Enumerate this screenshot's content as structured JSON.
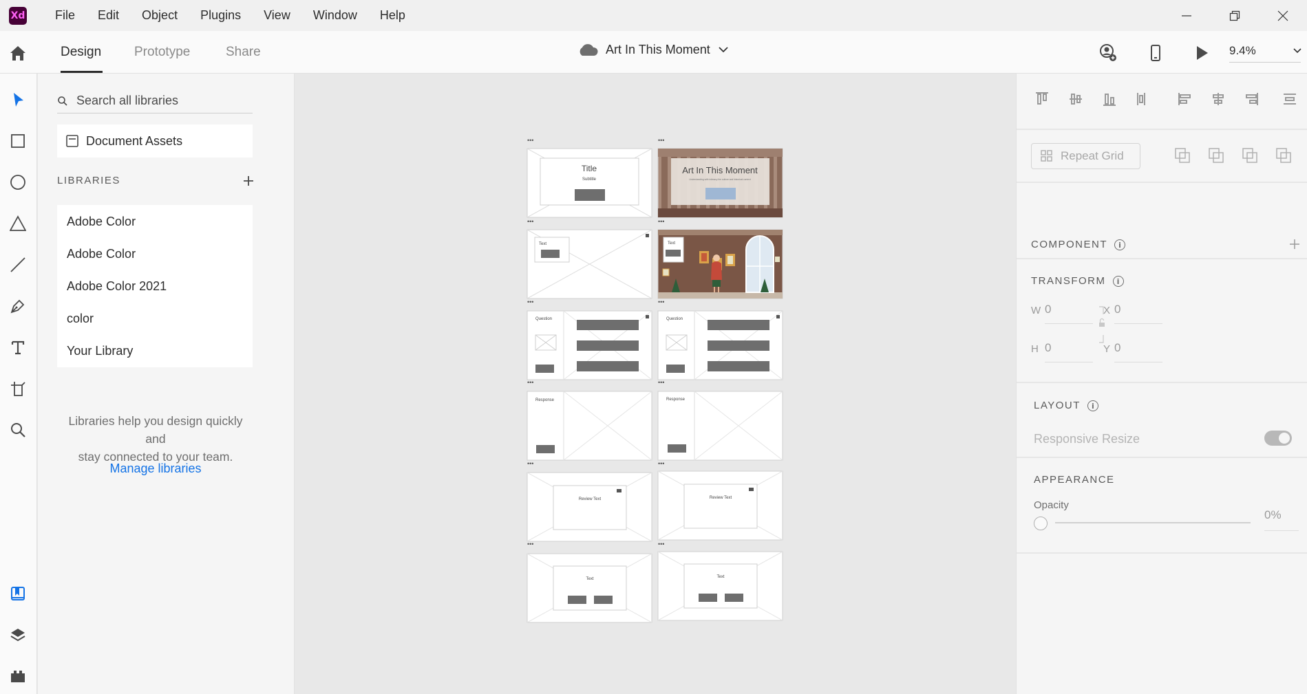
{
  "app": {
    "logo": "Xd"
  },
  "menu": [
    "File",
    "Edit",
    "Object",
    "Plugins",
    "View",
    "Window",
    "Help"
  ],
  "toolbar": {
    "tabs": [
      "Design",
      "Prototype",
      "Share"
    ],
    "active_tab": "Design",
    "doc_title": "Art In This Moment",
    "zoom": "9.4%"
  },
  "library": {
    "search_placeholder": "Search all libraries",
    "document_assets": "Document Assets",
    "libraries_heading": "LIBRARIES",
    "items": [
      "Adobe Color",
      "Adobe Color",
      "Adobe Color 2021",
      "color",
      "Your Library"
    ],
    "help_line1": "Libraries help you design quickly and",
    "help_line2": "stay connected to your team.",
    "manage_link": "Manage libraries"
  },
  "artboards": {
    "a1": {
      "title": "Title",
      "subtitle": "Subtitle"
    },
    "a2": {
      "title": "Art In This Moment",
      "sub": "Understanding with intimacy the culture and historical context"
    },
    "a3": {
      "label": "Text"
    },
    "a4": {
      "label": "Text"
    },
    "a5": {
      "label": "Question"
    },
    "a6": {
      "label": "Question"
    },
    "a7": {
      "label": "Response"
    },
    "a8": {
      "label": "Response"
    },
    "a9": {
      "label": "Review Text"
    },
    "a10": {
      "label": "Review Text"
    },
    "a11": {
      "label": "Text"
    },
    "a12": {
      "label": "Text"
    }
  },
  "right": {
    "repeat_grid": "Repeat Grid",
    "component": "COMPONENT",
    "transform": "TRANSFORM",
    "w_label": "W",
    "w_val": "0",
    "h_label": "H",
    "h_val": "0",
    "x_label": "X",
    "x_val": "0",
    "y_label": "Y",
    "y_val": "0",
    "layout": "LAYOUT",
    "responsive": "Responsive Resize",
    "appearance": "APPEARANCE",
    "opacity_label": "Opacity",
    "opacity_val": "0%"
  },
  "colors": {
    "accent": "#1473e6",
    "brand": "#470137",
    "brand_text": "#ff61f6"
  }
}
